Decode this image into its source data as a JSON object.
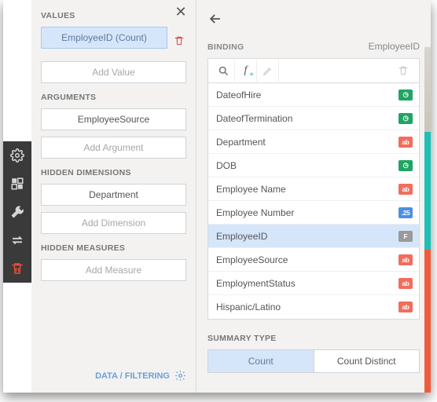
{
  "leftPanel": {
    "sections": {
      "values": {
        "title": "VALUES",
        "item": "EmployeeID (Count)",
        "add": "Add Value"
      },
      "arguments": {
        "title": "ARGUMENTS",
        "item": "EmployeeSource",
        "add": "Add Argument"
      },
      "hiddenDimensions": {
        "title": "HIDDEN DIMENSIONS",
        "item": "Department",
        "add": "Add Dimension"
      },
      "hiddenMeasures": {
        "title": "HIDDEN MEASURES",
        "add": "Add Measure"
      }
    },
    "footer": "DATA / FILTERING"
  },
  "rightPanel": {
    "bindingLabel": "BINDING",
    "currentField": "EmployeeID",
    "fields": [
      {
        "name": "DateofHire",
        "type": "date"
      },
      {
        "name": "DateofTermination",
        "type": "date"
      },
      {
        "name": "Department",
        "type": "text"
      },
      {
        "name": "DOB",
        "type": "date"
      },
      {
        "name": "Employee Name",
        "type": "text"
      },
      {
        "name": "Employee Number",
        "type": "num"
      },
      {
        "name": "EmployeeID",
        "type": "fmt",
        "selected": true
      },
      {
        "name": "EmployeeSource",
        "type": "text"
      },
      {
        "name": "EmploymentStatus",
        "type": "text"
      },
      {
        "name": "Hispanic/Latino",
        "type": "text"
      }
    ],
    "summary": {
      "title": "SUMMARY TYPE",
      "options": [
        "Count",
        "Count Distinct"
      ],
      "active": "Count"
    }
  },
  "typeLabels": {
    "date": "◷",
    "text": "ab",
    "num": ".25",
    "fmt": "F"
  }
}
